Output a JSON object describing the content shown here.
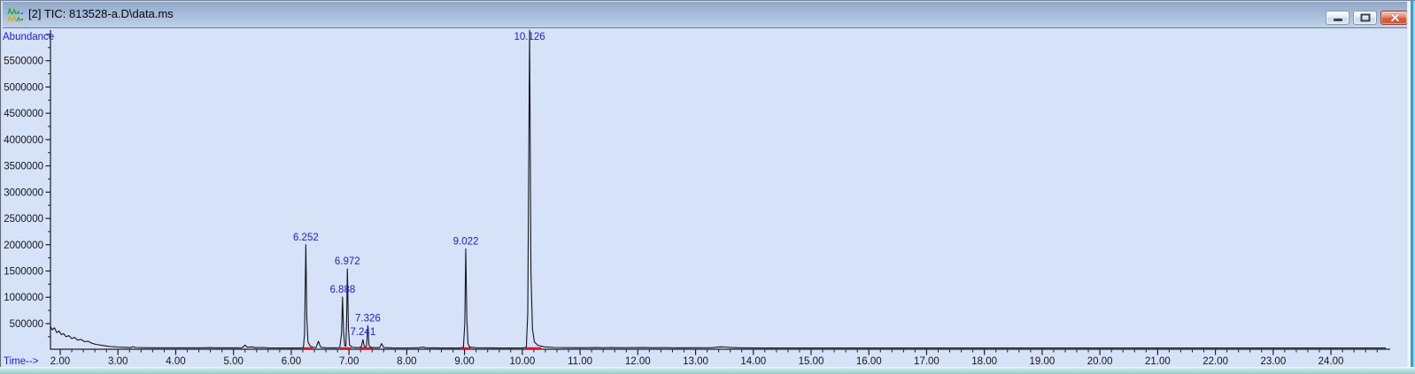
{
  "window": {
    "title": "[2] TIC: 813528-a.D\\data.ms"
  },
  "chart_data": {
    "type": "line",
    "title": "TIC: 813528-a.D\\data.ms",
    "xlabel": "Time-->",
    "ylabel": "Abundance",
    "x_axis": {
      "min": 2.0,
      "max": 24.95,
      "major_step": 1.0,
      "minor_step": 0.2,
      "tick_labels": [
        "2.00",
        "3.00",
        "4.00",
        "5.00",
        "6.00",
        "7.00",
        "8.00",
        "9.00",
        "10.00",
        "11.00",
        "12.00",
        "13.00",
        "14.00",
        "15.00",
        "16.00",
        "17.00",
        "18.00",
        "19.00",
        "20.00",
        "21.00",
        "22.00",
        "23.00",
        "24.00"
      ]
    },
    "y_axis": {
      "min": 0,
      "max": 6100000,
      "major_step": 500000,
      "minor_step": 250000,
      "tick_labels": [
        "500000",
        "1000000",
        "1500000",
        "2000000",
        "2500000",
        "3000000",
        "3500000",
        "4000000",
        "4500000",
        "5000000",
        "5500000"
      ]
    },
    "grid": false,
    "peaks": [
      {
        "label": "6.252",
        "time": 6.252,
        "abundance": 2000000
      },
      {
        "label": "6.888",
        "time": 6.888,
        "abundance": 1005000
      },
      {
        "label": "6.972",
        "time": 6.972,
        "abundance": 1540000
      },
      {
        "label": "7.241",
        "time": 7.241,
        "abundance": 195000
      },
      {
        "label": "7.326",
        "time": 7.326,
        "abundance": 460000
      },
      {
        "label": "9.022",
        "time": 9.022,
        "abundance": 1920000
      },
      {
        "label": "10.126",
        "time": 10.126,
        "abundance": 6080000
      }
    ],
    "integration_baselines": [
      [
        6.21,
        6.37
      ],
      [
        6.85,
        7.04
      ],
      [
        7.19,
        7.41
      ],
      [
        8.96,
        9.11
      ],
      [
        10.06,
        10.33
      ]
    ],
    "trace": [
      [
        1.83,
        450000
      ],
      [
        1.86,
        380000
      ],
      [
        1.9,
        420000
      ],
      [
        1.94,
        330000
      ],
      [
        1.98,
        360000
      ],
      [
        2.02,
        290000
      ],
      [
        2.06,
        310000
      ],
      [
        2.1,
        250000
      ],
      [
        2.15,
        270000
      ],
      [
        2.2,
        215000
      ],
      [
        2.25,
        235000
      ],
      [
        2.3,
        185000
      ],
      [
        2.36,
        200000
      ],
      [
        2.42,
        155000
      ],
      [
        2.48,
        165000
      ],
      [
        2.55,
        125000
      ],
      [
        2.62,
        105000
      ],
      [
        2.72,
        85000
      ],
      [
        2.85,
        65000
      ],
      [
        3.0,
        54000
      ],
      [
        3.15,
        47000
      ],
      [
        3.22,
        44000
      ],
      [
        3.26,
        62000
      ],
      [
        3.3,
        46000
      ],
      [
        3.5,
        41000
      ],
      [
        3.8,
        39000
      ],
      [
        4.1,
        38000
      ],
      [
        4.4,
        38000
      ],
      [
        4.6,
        42000
      ],
      [
        4.7,
        38000
      ],
      [
        5.0,
        38000
      ],
      [
        5.15,
        40000
      ],
      [
        5.2,
        90000
      ],
      [
        5.24,
        48000
      ],
      [
        5.32,
        58000
      ],
      [
        5.38,
        42000
      ],
      [
        5.52,
        46000
      ],
      [
        5.6,
        38000
      ],
      [
        5.9,
        36000
      ],
      [
        6.15,
        36000
      ],
      [
        6.21,
        42000
      ],
      [
        6.23,
        300000
      ],
      [
        6.252,
        2000000
      ],
      [
        6.27,
        600000
      ],
      [
        6.29,
        150000
      ],
      [
        6.33,
        70000
      ],
      [
        6.38,
        48000
      ],
      [
        6.43,
        44000
      ],
      [
        6.47,
        165000
      ],
      [
        6.51,
        48000
      ],
      [
        6.6,
        40000
      ],
      [
        6.75,
        38000
      ],
      [
        6.84,
        42000
      ],
      [
        6.87,
        300000
      ],
      [
        6.888,
        1005000
      ],
      [
        6.905,
        350000
      ],
      [
        6.925,
        80000
      ],
      [
        6.945,
        70000
      ],
      [
        6.958,
        500000
      ],
      [
        6.972,
        1540000
      ],
      [
        6.99,
        400000
      ],
      [
        7.01,
        90000
      ],
      [
        7.06,
        48000
      ],
      [
        7.15,
        42000
      ],
      [
        7.21,
        50000
      ],
      [
        7.241,
        195000
      ],
      [
        7.265,
        60000
      ],
      [
        7.29,
        55000
      ],
      [
        7.305,
        80000
      ],
      [
        7.326,
        460000
      ],
      [
        7.345,
        90000
      ],
      [
        7.37,
        48000
      ],
      [
        7.43,
        42000
      ],
      [
        7.53,
        42000
      ],
      [
        7.565,
        120000
      ],
      [
        7.6,
        44000
      ],
      [
        7.75,
        38000
      ],
      [
        8.1,
        37000
      ],
      [
        8.22,
        42000
      ],
      [
        8.27,
        52000
      ],
      [
        8.33,
        40000
      ],
      [
        8.6,
        36000
      ],
      [
        8.9,
        36000
      ],
      [
        8.98,
        44000
      ],
      [
        9.005,
        500000
      ],
      [
        9.022,
        1920000
      ],
      [
        9.04,
        600000
      ],
      [
        9.06,
        120000
      ],
      [
        9.09,
        52000
      ],
      [
        9.2,
        40000
      ],
      [
        9.6,
        36000
      ],
      [
        10.0,
        36000
      ],
      [
        10.07,
        48000
      ],
      [
        10.095,
        700000
      ],
      [
        10.126,
        6080000
      ],
      [
        10.15,
        1500000
      ],
      [
        10.175,
        400000
      ],
      [
        10.21,
        150000
      ],
      [
        10.27,
        85000
      ],
      [
        10.38,
        58000
      ],
      [
        10.55,
        46000
      ],
      [
        10.8,
        42000
      ],
      [
        11.05,
        40000
      ],
      [
        11.3,
        44000
      ],
      [
        11.42,
        40000
      ],
      [
        11.55,
        44000
      ],
      [
        11.7,
        40000
      ],
      [
        11.95,
        42000
      ],
      [
        12.1,
        44000
      ],
      [
        12.25,
        40000
      ],
      [
        12.45,
        42000
      ],
      [
        12.7,
        38000
      ],
      [
        13.0,
        40000
      ],
      [
        13.3,
        42000
      ],
      [
        13.42,
        58000
      ],
      [
        13.52,
        54000
      ],
      [
        13.62,
        44000
      ],
      [
        13.8,
        38000
      ],
      [
        14.2,
        36000
      ],
      [
        15.0,
        35000
      ],
      [
        16.0,
        35000
      ],
      [
        17.0,
        35000
      ],
      [
        18.0,
        35000
      ],
      [
        19.0,
        35000
      ],
      [
        20.0,
        35000
      ],
      [
        21.0,
        35000
      ],
      [
        22.0,
        35000
      ],
      [
        23.0,
        35000
      ],
      [
        24.0,
        35000
      ],
      [
        24.95,
        35000
      ]
    ],
    "colors": {
      "plot_bg": "#d6e2f8",
      "trace": "#15151d",
      "axis": "#1c1c24",
      "tick_text": "#15151a",
      "axis_label": "#2021cd",
      "peak_label": "#2021cd",
      "integration": "#e3111b"
    }
  }
}
